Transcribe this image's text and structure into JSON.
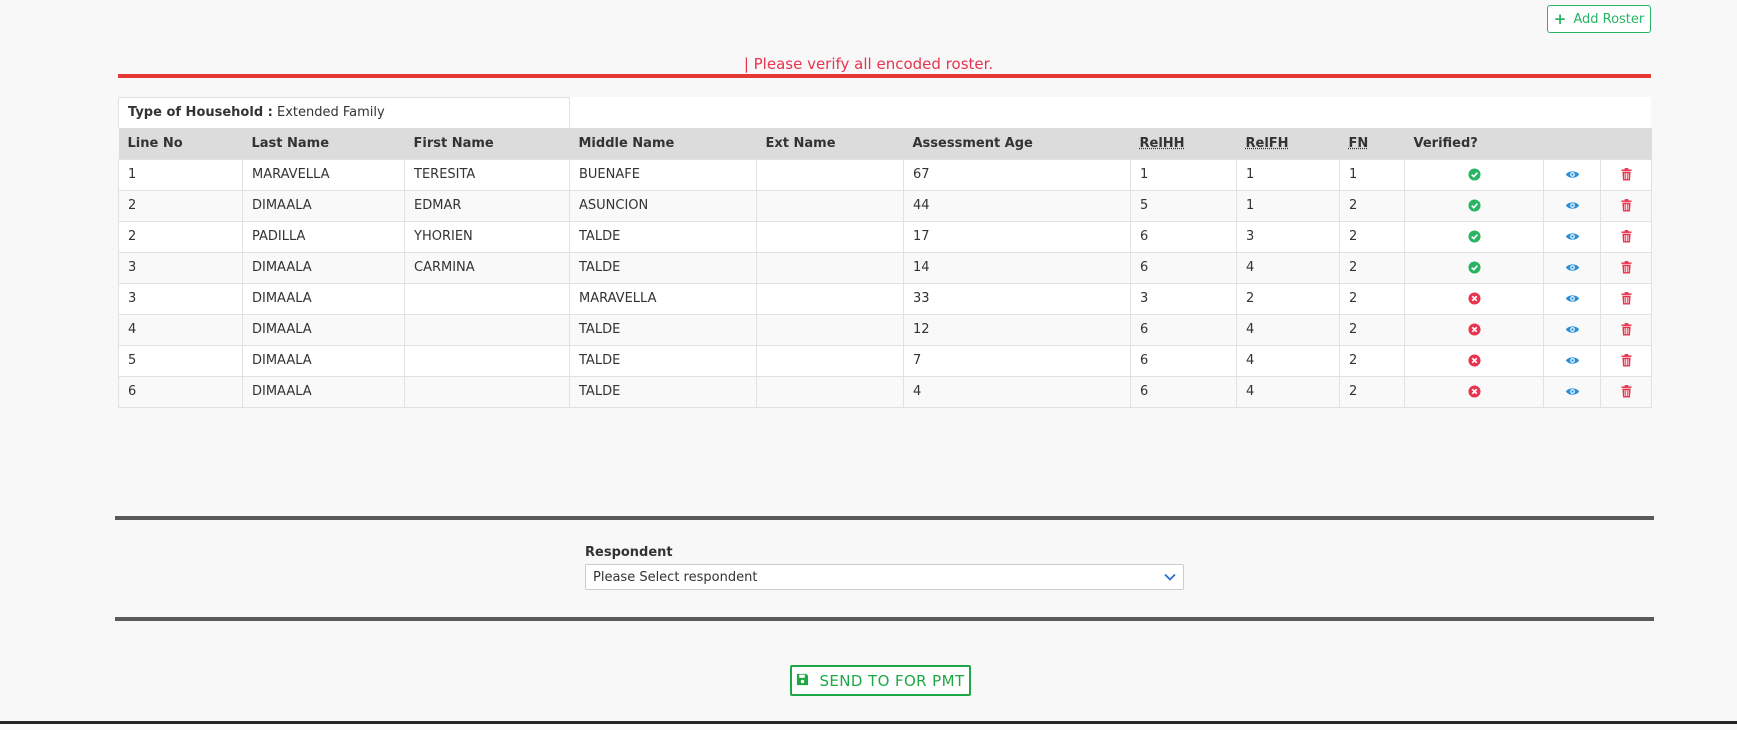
{
  "toolbar": {
    "add_roster_label": "Add Roster"
  },
  "warning": "| Please verify all encoded roster.",
  "household": {
    "type_label": "Type of Household :",
    "type_value": "Extended Family"
  },
  "table": {
    "headers": {
      "line_no": "Line No",
      "last_name": "Last Name",
      "first_name": "First Name",
      "middle_name": "Middle Name",
      "ext_name": "Ext Name",
      "assessment_age": "Assessment Age",
      "relhh": "RelHH",
      "relfh": "RelFH",
      "fn": "FN",
      "verified": "Verified?"
    },
    "rows": [
      {
        "line_no": "1",
        "last_name": "MARAVELLA",
        "first_name": "TERESITA",
        "middle_name": "BUENAFE",
        "ext_name": "",
        "age": "67",
        "relhh": "1",
        "relfh": "1",
        "fn": "1",
        "verified": true
      },
      {
        "line_no": "2",
        "last_name": "DIMAALA",
        "first_name": "EDMAR",
        "middle_name": "ASUNCION",
        "ext_name": "",
        "age": "44",
        "relhh": "5",
        "relfh": "1",
        "fn": "2",
        "verified": true
      },
      {
        "line_no": "2",
        "last_name": "PADILLA",
        "first_name": "YHORIEN",
        "middle_name": "TALDE",
        "ext_name": "",
        "age": "17",
        "relhh": "6",
        "relfh": "3",
        "fn": "2",
        "verified": true
      },
      {
        "line_no": "3",
        "last_name": "DIMAALA",
        "first_name": "CARMINA",
        "middle_name": "TALDE",
        "ext_name": "",
        "age": "14",
        "relhh": "6",
        "relfh": "4",
        "fn": "2",
        "verified": true
      },
      {
        "line_no": "3",
        "last_name": "DIMAALA",
        "first_name": "",
        "middle_name": "MARAVELLA",
        "ext_name": "",
        "age": "33",
        "relhh": "3",
        "relfh": "2",
        "fn": "2",
        "verified": false
      },
      {
        "line_no": "4",
        "last_name": "DIMAALA",
        "first_name": "",
        "middle_name": "TALDE",
        "ext_name": "",
        "age": "12",
        "relhh": "6",
        "relfh": "4",
        "fn": "2",
        "verified": false
      },
      {
        "line_no": "5",
        "last_name": "DIMAALA",
        "first_name": "",
        "middle_name": "TALDE",
        "ext_name": "",
        "age": "7",
        "relhh": "6",
        "relfh": "4",
        "fn": "2",
        "verified": false
      },
      {
        "line_no": "6",
        "last_name": "DIMAALA",
        "first_name": "",
        "middle_name": "TALDE",
        "ext_name": "",
        "age": "4",
        "relhh": "6",
        "relfh": "4",
        "fn": "2",
        "verified": false
      }
    ],
    "icons": {
      "verified_true": "check-circle-icon",
      "verified_false": "x-circle-icon",
      "view": "eye-icon",
      "delete": "trash-icon"
    }
  },
  "respondent": {
    "label": "Respondent",
    "selected": "Please Select respondent"
  },
  "send_button": {
    "label": "SEND TO FOR PMT",
    "icon": "save-icon"
  },
  "colors": {
    "accent_green": "#28b463",
    "warning_red": "#e8344e",
    "view_blue": "#2a8fd6",
    "delete_red": "#e8344e",
    "header_gray": "#dcdcdc"
  }
}
